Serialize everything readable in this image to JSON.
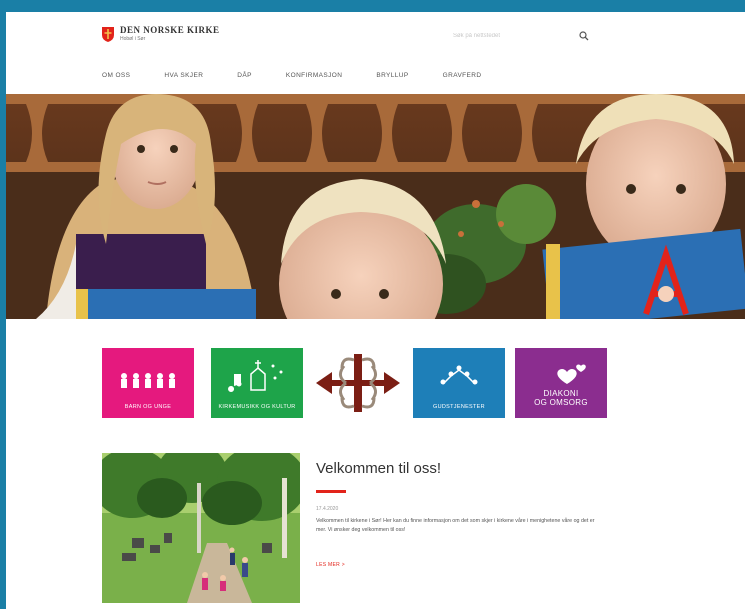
{
  "header": {
    "logo_name": "DEN NORSKE KIRKE",
    "logo_sub": "Hobøl i Sør",
    "search_placeholder": "Søk på nettstedet"
  },
  "nav": {
    "items": [
      "Om oss",
      "Hva skjer",
      "Dåp",
      "Konfirmasjon",
      "Bryllup",
      "Gravferd"
    ]
  },
  "tiles": [
    {
      "label": "BARN OG UNGE",
      "color": "#e5197e",
      "icon": "children-icon"
    },
    {
      "label": "KIRKEMUSIKK OG KULTUR",
      "color": "#1ea44a",
      "icon": "music-church-icon"
    },
    {
      "label": "",
      "color": "#ffffff",
      "icon": "church-cross-emblem-icon"
    },
    {
      "label": "GUDSTJENESTER",
      "color": "#1e7fb8",
      "icon": "community-icon"
    },
    {
      "label": "DIAKONI\nOG OMSORG",
      "color": "#8b2d8f",
      "icon": "hearts-icon"
    }
  ],
  "article": {
    "title": "Velkommen til oss!",
    "date": "17.4.2020",
    "body": "Velkommen til kirkene i Sør! Her kan du finne informasjon om det som skjer i kirkene våre i menighetene våre og det er mer. Vi ønsker deg velkommen til oss!",
    "read_more": "LES MER >"
  },
  "colors": {
    "frame": "#1a7fa6",
    "accent": "#e2231a"
  }
}
